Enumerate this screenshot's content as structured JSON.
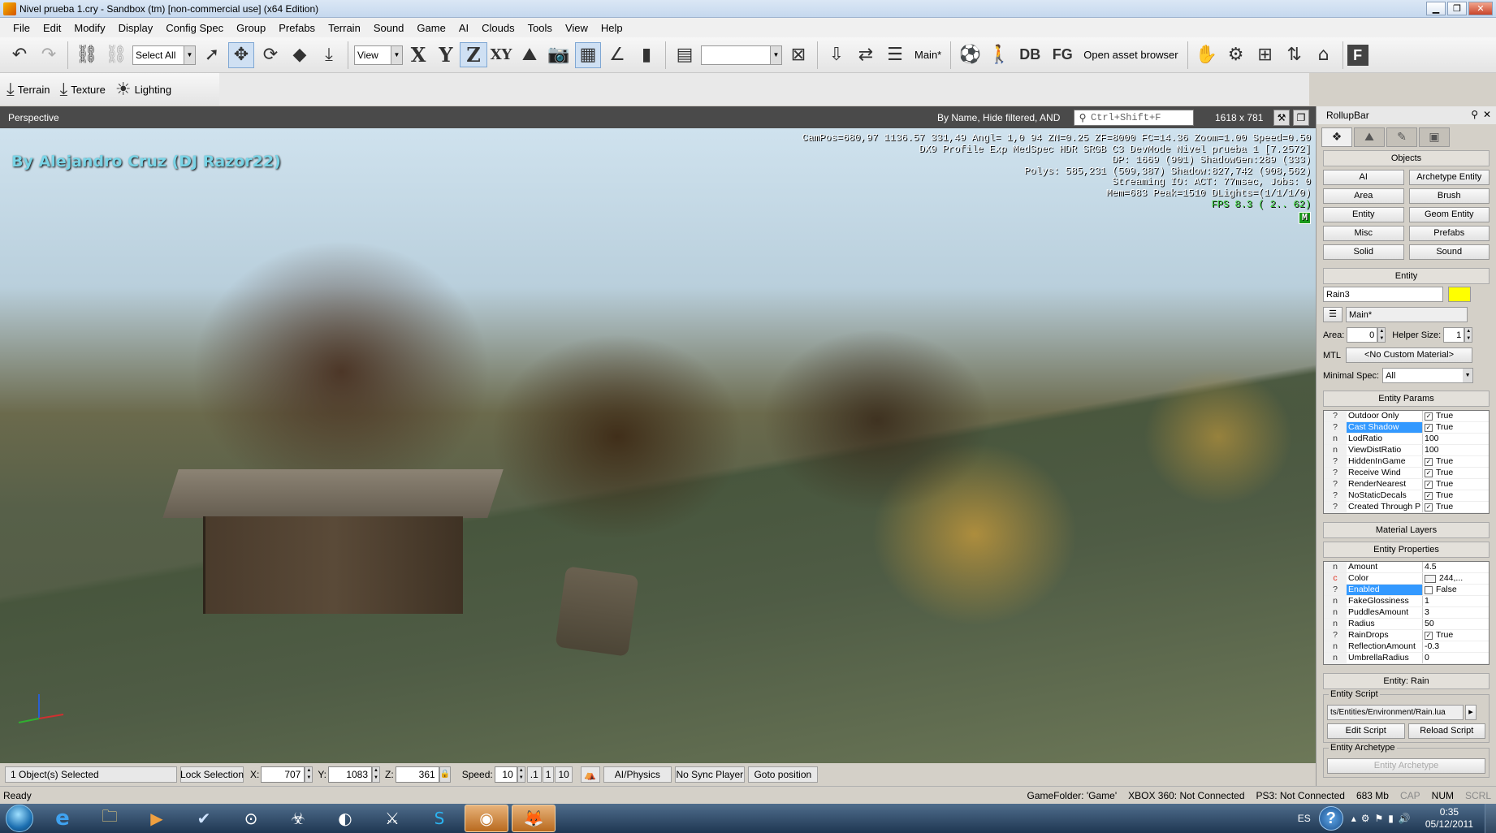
{
  "window": {
    "title": "Nivel prueba 1.cry - Sandbox (tm) [non-commercial use] (x64 Edition)"
  },
  "menu": [
    "File",
    "Edit",
    "Modify",
    "Display",
    "Config Spec",
    "Group",
    "Prefabs",
    "Terrain",
    "Sound",
    "Game",
    "AI",
    "Clouds",
    "Tools",
    "View",
    "Help"
  ],
  "toolbar": {
    "select_all": "Select All",
    "ref_coord": "View",
    "axis_x": "X",
    "axis_y": "Y",
    "axis_z": "Z",
    "axis_xy": "XY",
    "layer": "Main*",
    "db": "DB",
    "fg": "FG",
    "open_asset_browser": "Open asset browser",
    "f": "F"
  },
  "toolbar2": {
    "terrain": "Terrain",
    "texture": "Texture",
    "lighting": "Lighting"
  },
  "viewport": {
    "title": "Perspective",
    "filter": "By Name, Hide filtered, AND",
    "search_placeholder": "Ctrl+Shift+F",
    "resolution": "1618 x 781",
    "watermark": "By Alejandro Cruz (DJ Razor22)",
    "debug": {
      "line1": "CamPos=680,97 1136.57 331,49 Angl=  1,0  94 ZN=0.25 ZF=8000 FC=14.36 Zoom=1.00 Speed=0.50",
      "line2": "DX9 Profile Exp  MedSpec HDR SRGB C3 DevMode Nivel prueba 1 [7.2572]",
      "line3": "DP: 1669 (901) ShadowGen:289 (333)",
      "line4": "Polys: 585,231 (509,387) Shadow:827,742 (908,562)",
      "line5": "Streaming IO: ACT: 77msec, Jobs: 0",
      "line6": "Mem=683 Peak=1510 DLights=(1/1/1/0)",
      "fps": "FPS   8.3 (  2.. 62)",
      "badge": "M"
    }
  },
  "status": {
    "selected": "1 Object(s) Selected",
    "lock_selection": "Lock Selection",
    "x_label": "X:",
    "x": "707",
    "y_label": "Y:",
    "y": "1083",
    "z_label": "Z:",
    "z": "361",
    "speed_label": "Speed:",
    "speed": "10",
    "s1": ".1",
    "s2": "1",
    "s3": "10",
    "ai_physics": "AI/Physics",
    "no_sync": "No Sync Player",
    "goto": "Goto position"
  },
  "statusline": {
    "ready": "Ready",
    "gamefolder": "GameFolder: 'Game'",
    "xbox": "XBOX 360: Not Connected",
    "ps3": "PS3: Not Connected",
    "mem": "683 Mb",
    "cap": "CAP",
    "num": "NUM",
    "scrl": "SCRL"
  },
  "rollup": {
    "title": "RollupBar",
    "objects_header": "Objects",
    "objects": [
      "AI",
      "Archetype Entity",
      "Area",
      "Brush",
      "Entity",
      "Geom Entity",
      "Misc",
      "Prefabs",
      "Solid",
      "Sound"
    ],
    "entity_header": "Entity",
    "entity_name": "Rain3",
    "entity_color": "#ffff00",
    "layer": "Main*",
    "area_label": "Area:",
    "area": "0",
    "helper_label": "Helper Size:",
    "helper": "1",
    "mtl_label": "MTL",
    "mtl": "<No Custom Material>",
    "minspec_label": "Minimal Spec:",
    "minspec": "All",
    "params_header": "Entity Params",
    "params": [
      {
        "i": "?",
        "n": "Outdoor Only",
        "cb": "true",
        "v": "True"
      },
      {
        "i": "?",
        "n": "Cast Shadow",
        "cb": "true",
        "v": "True",
        "sel": true
      },
      {
        "i": "n",
        "n": "LodRatio",
        "v": "100"
      },
      {
        "i": "n",
        "n": "ViewDistRatio",
        "v": "100"
      },
      {
        "i": "?",
        "n": "HiddenInGame",
        "cb": "true",
        "v": "True"
      },
      {
        "i": "?",
        "n": "Receive Wind",
        "cb": "true",
        "v": "True"
      },
      {
        "i": "?",
        "n": "RenderNearest",
        "cb": "true",
        "v": "True"
      },
      {
        "i": "?",
        "n": "NoStaticDecals",
        "cb": "true",
        "v": "True"
      },
      {
        "i": "?",
        "n": "Created Through P",
        "cb": "true",
        "v": "True"
      }
    ],
    "material_layers": "Material Layers",
    "props_header": "Entity Properties",
    "props": [
      {
        "i": "n",
        "n": "Amount",
        "v": "4.5"
      },
      {
        "i": "c",
        "n": "Color",
        "v": "244,..."
      },
      {
        "i": "?",
        "n": "Enabled",
        "cb": "false",
        "v": "False",
        "sel": true
      },
      {
        "i": "n",
        "n": "FakeGlossiness",
        "v": "1"
      },
      {
        "i": "n",
        "n": "PuddlesAmount",
        "v": "3"
      },
      {
        "i": "n",
        "n": "Radius",
        "v": "50"
      },
      {
        "i": "?",
        "n": "RainDrops",
        "cb": "true",
        "v": "True"
      },
      {
        "i": "n",
        "n": "ReflectionAmount",
        "v": "-0.3"
      },
      {
        "i": "n",
        "n": "UmbrellaRadius",
        "v": "0"
      }
    ],
    "entity_rain": "Entity: Rain",
    "script_group": "Entity Script",
    "script_path": "ts/Entities/Environment/Rain.lua",
    "edit_script": "Edit Script",
    "reload_script": "Reload Script",
    "archetype_group": "Entity Archetype",
    "archetype_btn": "Entity Archetype"
  },
  "taskbar": {
    "lang": "ES",
    "time": "0:35",
    "date": "05/12/2011"
  }
}
